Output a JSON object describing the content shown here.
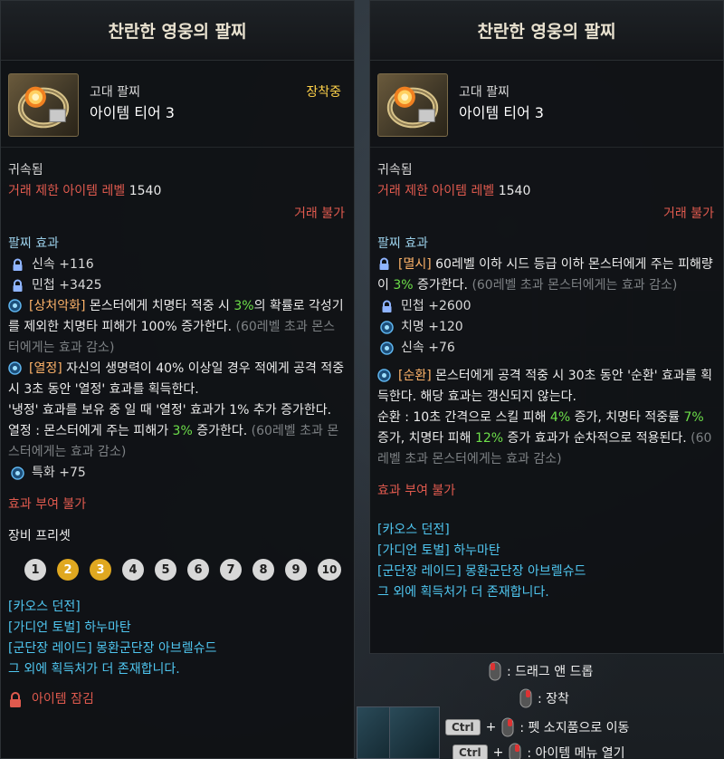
{
  "left": {
    "title": "찬란한 영웅의 팔찌",
    "item_type": "고대 팔찌",
    "item_tier": "아이템 티어 3",
    "equipped": "장착중",
    "bound": "귀속됨",
    "trade_level_label": "거래 제한 아이템 레벨",
    "trade_level_value": "1540",
    "no_trade": "거래 불가",
    "effects_title": "팔찌 효과",
    "stat1": "신속 +116",
    "stat2": "민첩 +3425",
    "e1_tag": "[상처악화]",
    "e1_a": " 몬스터에게 치명타 적중 시 ",
    "e1_pct": "3%",
    "e1_b": "의 확률로 각성기를 제외한 치명타 피해가 100% 증가한다. ",
    "e1_note": "(60레벨 초과 몬스터에게는 효과 감소)",
    "e2_tag": "[열정]",
    "e2_a": " 자신의 생명력이 40% 이상일 경우 적에게 공격 적중 시 3초 동안 '열정' 효과를 획득한다.",
    "e2_b": "'냉정' 효과를 보유 중 일 때 '열정' 효과가 1% 추가 증가한다.",
    "e2_c": "열정 : 몬스터에게 주는 피해가 ",
    "e2_pct": "3%",
    "e2_d": " 증가한다. ",
    "e2_note": "(60레벨 초과 몬스터에게는 효과 감소)",
    "stat3": "특화 +75",
    "no_enchant": "효과 부여 불가",
    "preset_title": "장비 프리셋",
    "presets": [
      "1",
      "2",
      "3",
      "4",
      "5",
      "6",
      "7",
      "8",
      "9",
      "10"
    ],
    "sources": [
      "[카오스 던전]",
      "[가디언 토벌] 하누마탄",
      "[군단장 레이드] 몽환군단장 아브렐슈드",
      "그 외에 획득처가 더 존재합니다."
    ],
    "lock_label": "아이템 잠김"
  },
  "right": {
    "title": "찬란한 영웅의 팔찌",
    "item_type": "고대 팔찌",
    "item_tier": "아이템 티어 3",
    "bound": "귀속됨",
    "trade_level_label": "거래 제한 아이템 레벨",
    "trade_level_value": "1540",
    "no_trade": "거래 불가",
    "effects_title": "팔찌 효과",
    "e1_tag": "[멸시]",
    "e1_a": " 60레벨 이하 시드 등급 이하 몬스터에게 주는 피해량이 ",
    "e1_pct": "3%",
    "e1_b": " 증가한다. ",
    "e1_note": "(60레벨 초과 몬스터에게는 효과 감소)",
    "stat1": "민첩 +2600",
    "stat2": "치명 +120",
    "stat3": "신속 +76",
    "e2_tag": "[순환]",
    "e2_a": " 몬스터에게 공격 적중 시 30초 동안 '순환' 효과를 획득한다. 해당 효과는 갱신되지 않는다.",
    "e2_b": "순환 : 10초 간격으로 스킬 피해 ",
    "e2_p1": "4%",
    "e2_c": " 증가, 치명타 적중률 ",
    "e2_p2": "7%",
    "e2_d": " 증가, 치명타 피해 ",
    "e2_p3": "12%",
    "e2_e": " 증가 효과가 순차적으로 적용된다. ",
    "e2_note": "(60레벨 초과 몬스터에게는 효과 감소)",
    "no_enchant": "효과 부여 불가",
    "sources": [
      "[카오스 던전]",
      "[가디언 토벌] 하누마탄",
      "[군단장 레이드] 몽환군단장 아브렐슈드",
      "그 외에 획득처가 더 존재합니다."
    ]
  },
  "hints": {
    "drag": ": 드래그 앤 드롭",
    "equip": ": 장착",
    "ctrl": "Ctrl",
    "plus": "+",
    "move_pet": ": 펫 소지품으로 이동",
    "item_menu": ": 아이템 메뉴 열기"
  },
  "colors": {
    "title": "#e9e2d0",
    "red": "#e05a4e",
    "green": "#6ddf4a",
    "orange": "#ffb46a",
    "blue": "#4fc6f0",
    "gold": "#ffd24a",
    "section": "#9bd0ea"
  }
}
